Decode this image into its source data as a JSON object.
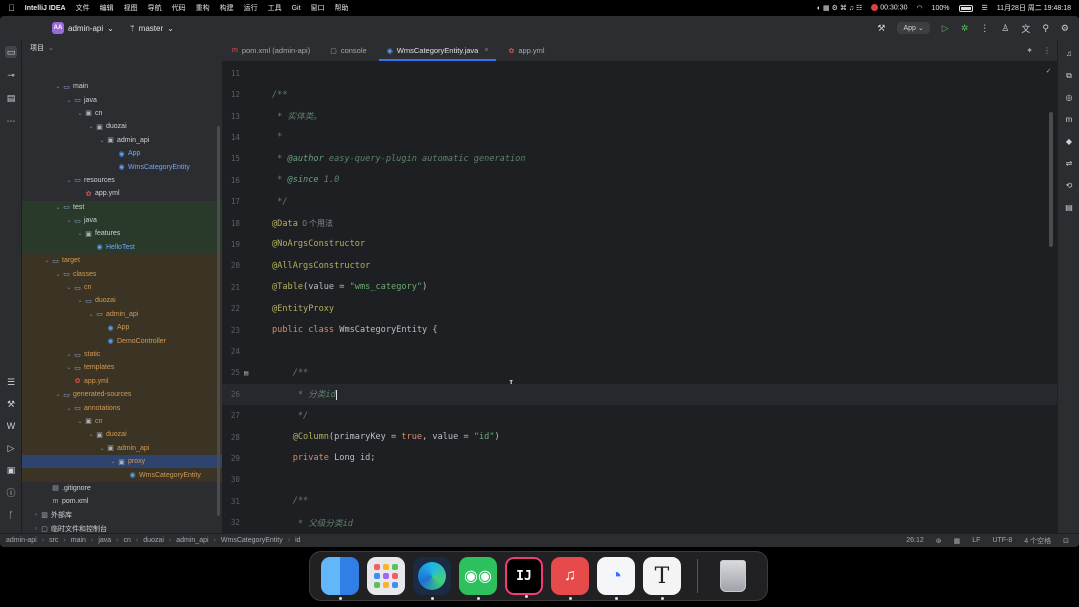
{
  "menubar": {
    "app": "IntelliJ IDEA",
    "items": [
      "文件",
      "编辑",
      "视图",
      "导航",
      "代码",
      "重构",
      "构建",
      "运行",
      "工具",
      "Git",
      "窗口",
      "帮助"
    ],
    "recording": "00:30:30",
    "battery": "100%",
    "datetime": "11月28日 周二  19:48:18"
  },
  "titlebar": {
    "project_badge": "AA",
    "project": "admin-api",
    "branch": "master",
    "run_config": "App"
  },
  "project_panel": {
    "title": "项目",
    "rows": [
      {
        "label": "main",
        "depth": 2,
        "icon": "folder-icon",
        "style": "normal"
      },
      {
        "label": "java",
        "depth": 3,
        "icon": "folder-icon",
        "style": "normal"
      },
      {
        "label": "cn",
        "depth": 4,
        "icon": "package-icon",
        "style": "normal"
      },
      {
        "label": "duozai",
        "depth": 5,
        "icon": "package-icon",
        "style": "normal"
      },
      {
        "label": "admin_api",
        "depth": 6,
        "icon": "package-icon",
        "style": "normal"
      },
      {
        "label": "App",
        "depth": 7,
        "icon": "class-icon",
        "style": "blue"
      },
      {
        "label": "WmsCategoryEntity",
        "depth": 7,
        "icon": "class-icon",
        "style": "blue"
      },
      {
        "label": "resources",
        "depth": 3,
        "icon": "folder-icon",
        "style": "normal"
      },
      {
        "label": "app.yml",
        "depth": 4,
        "icon": "yml-icon",
        "style": "normal"
      },
      {
        "label": "test",
        "depth": 2,
        "icon": "folder-icon",
        "style": "test"
      },
      {
        "label": "java",
        "depth": 3,
        "icon": "folder-icon",
        "style": "test"
      },
      {
        "label": "features",
        "depth": 4,
        "icon": "package-icon",
        "style": "test"
      },
      {
        "label": "HelloTest",
        "depth": 5,
        "icon": "class-icon",
        "style": "test-blue"
      },
      {
        "label": "target",
        "depth": 1,
        "icon": "folder-icon",
        "style": "excluded"
      },
      {
        "label": "classes",
        "depth": 2,
        "icon": "folder-icon",
        "style": "excluded"
      },
      {
        "label": "cn",
        "depth": 3,
        "icon": "folder-icon",
        "style": "excluded"
      },
      {
        "label": "duozai",
        "depth": 4,
        "icon": "folder-icon",
        "style": "excluded"
      },
      {
        "label": "admin_api",
        "depth": 5,
        "icon": "folder-icon",
        "style": "excluded"
      },
      {
        "label": "App",
        "depth": 6,
        "icon": "class-icon",
        "style": "excluded"
      },
      {
        "label": "DemoController",
        "depth": 6,
        "icon": "class-icon",
        "style": "excluded"
      },
      {
        "label": "static",
        "depth": 3,
        "icon": "folder-icon",
        "style": "excluded"
      },
      {
        "label": "templates",
        "depth": 3,
        "icon": "folder-icon",
        "style": "excluded"
      },
      {
        "label": "app.yml",
        "depth": 3,
        "icon": "yml-icon",
        "style": "excluded"
      },
      {
        "label": "generated-sources",
        "depth": 2,
        "icon": "folder-icon",
        "style": "excluded"
      },
      {
        "label": "annotations",
        "depth": 3,
        "icon": "folder-icon",
        "style": "excluded"
      },
      {
        "label": "cn",
        "depth": 4,
        "icon": "package-icon",
        "style": "excluded"
      },
      {
        "label": "duozai",
        "depth": 5,
        "icon": "package-icon",
        "style": "excluded"
      },
      {
        "label": "admin_api",
        "depth": 6,
        "icon": "package-icon",
        "style": "excluded"
      },
      {
        "label": "proxy",
        "depth": 7,
        "icon": "package-icon",
        "style": "selected"
      },
      {
        "label": "WmsCategoryEntity",
        "depth": 8,
        "icon": "class-icon",
        "style": "excluded"
      },
      {
        "label": ".gitignore",
        "depth": 1,
        "icon": "file-icon",
        "style": "normal"
      },
      {
        "label": "pom.xml",
        "depth": 1,
        "icon": "maven-icon",
        "style": "normal"
      },
      {
        "label": "外部库",
        "depth": 0,
        "icon": "library-icon",
        "style": "normal"
      },
      {
        "label": "临时文件和控制台",
        "depth": 0,
        "icon": "console-icon",
        "style": "normal"
      }
    ]
  },
  "tabs": [
    {
      "label": "pom.xml (admin-api)",
      "icon": "maven-icon",
      "active": false
    },
    {
      "label": "console",
      "icon": "console-icon",
      "active": false
    },
    {
      "label": "WmsCategoryEntity.java",
      "icon": "class-icon",
      "active": true
    },
    {
      "label": "app.yml",
      "icon": "yml-icon",
      "active": false
    }
  ],
  "editor": {
    "current_line": "26",
    "lines": [
      {
        "n": "11",
        "parts": []
      },
      {
        "n": "12",
        "parts": [
          {
            "t": "/**",
            "c": "c-doc"
          }
        ]
      },
      {
        "n": "13",
        "parts": [
          {
            "t": " * 实体类。",
            "c": "c-doc"
          }
        ]
      },
      {
        "n": "14",
        "parts": [
          {
            "t": " *",
            "c": "c-doc"
          }
        ]
      },
      {
        "n": "15",
        "parts": [
          {
            "t": " * ",
            "c": "c-doc"
          },
          {
            "t": "@author",
            "c": "c-tag"
          },
          {
            "t": " easy-query-plugin automatic generation",
            "c": "c-doc"
          }
        ]
      },
      {
        "n": "16",
        "parts": [
          {
            "t": " * ",
            "c": "c-doc"
          },
          {
            "t": "@since",
            "c": "c-tag"
          },
          {
            "t": " 1.0",
            "c": "c-doc"
          }
        ]
      },
      {
        "n": "17",
        "parts": [
          {
            "t": " */",
            "c": "c-doc"
          }
        ]
      },
      {
        "n": "18",
        "parts": [
          {
            "t": "@Data",
            "c": "c-anno"
          },
          {
            "t": "  0 个用法",
            "c": "c-hint"
          }
        ]
      },
      {
        "n": "19",
        "parts": [
          {
            "t": "@NoArgsConstructor",
            "c": "c-anno"
          }
        ]
      },
      {
        "n": "20",
        "parts": [
          {
            "t": "@AllArgsConstructor",
            "c": "c-anno"
          }
        ]
      },
      {
        "n": "21",
        "parts": [
          {
            "t": "@Table",
            "c": "c-anno"
          },
          {
            "t": "(value = ",
            "c": ""
          },
          {
            "t": "\"wms_category\"",
            "c": "c-str"
          },
          {
            "t": ")",
            "c": ""
          }
        ]
      },
      {
        "n": "22",
        "parts": [
          {
            "t": "@EntityProxy",
            "c": "c-anno"
          }
        ]
      },
      {
        "n": "23",
        "parts": [
          {
            "t": "public class ",
            "c": "c-kw"
          },
          {
            "t": "WmsCategoryEntity {",
            "c": ""
          }
        ]
      },
      {
        "n": "24",
        "parts": []
      },
      {
        "n": "25",
        "parts": [
          {
            "t": "    /**",
            "c": "c-doc"
          }
        ]
      },
      {
        "n": "26",
        "parts": [
          {
            "t": "     * 分类id",
            "c": "c-doc"
          }
        ]
      },
      {
        "n": "27",
        "parts": [
          {
            "t": "     */",
            "c": "c-doc"
          }
        ]
      },
      {
        "n": "28",
        "parts": [
          {
            "t": "    @Column",
            "c": "c-anno"
          },
          {
            "t": "(primaryKey = ",
            "c": ""
          },
          {
            "t": "true",
            "c": "c-kw"
          },
          {
            "t": ", value = ",
            "c": ""
          },
          {
            "t": "\"id\"",
            "c": "c-str"
          },
          {
            "t": ")",
            "c": ""
          }
        ]
      },
      {
        "n": "29",
        "parts": [
          {
            "t": "    private ",
            "c": "c-kw"
          },
          {
            "t": "Long id;",
            "c": ""
          }
        ]
      },
      {
        "n": "30",
        "parts": []
      },
      {
        "n": "31",
        "parts": [
          {
            "t": "    /**",
            "c": "c-doc"
          }
        ]
      },
      {
        "n": "32",
        "parts": [
          {
            "t": "     * 父级分类id",
            "c": "c-doc"
          }
        ]
      }
    ]
  },
  "statusbar": {
    "crumbs": [
      "admin-api",
      "src",
      "main",
      "java",
      "cn",
      "duozai",
      "admin_api",
      "WmsCategoryEntity",
      "id"
    ],
    "position": "26:12",
    "line_sep": "LF",
    "encoding": "UTF-8",
    "indent": "4 个空格"
  },
  "dock": {
    "apps": [
      "Finder",
      "Launchpad",
      "Microsoft Edge",
      "WeChat",
      "IntelliJ IDEA",
      "NetEase Cloud Music",
      "Lark",
      "Typora",
      "Trash"
    ],
    "intellij_glyph": "IJ",
    "typora_glyph": "T"
  },
  "colors": {
    "accent": "#3574f0",
    "ide_bg": "#1e1f22",
    "panel_bg": "#2b2d30",
    "annotation": "#b3ae60",
    "keyword": "#cf8e6d",
    "string": "#6aab73",
    "doc_comment": "#5f826b"
  }
}
